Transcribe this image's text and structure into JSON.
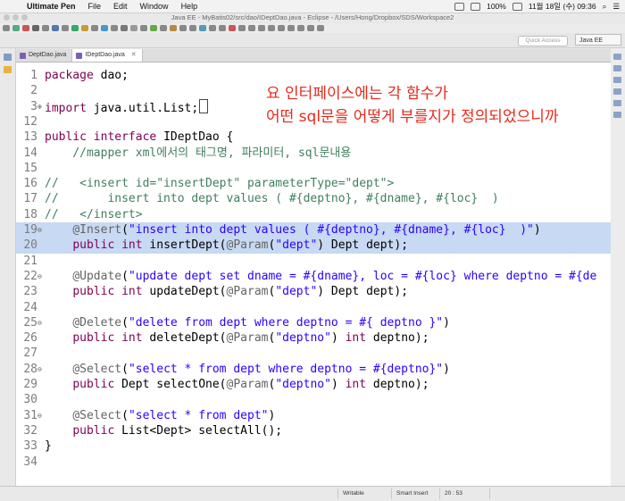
{
  "menubar": {
    "app_name": "Ultimate Pen",
    "items": [
      "File",
      "Edit",
      "Window",
      "Help"
    ],
    "battery": "100%",
    "date_time": "11월 18일 (수)  09:36"
  },
  "window": {
    "title": "Java EE - MyBatis02/src/dao/IDeptDao.java - Eclipse - /Users/Hong/Dropbox/SDS/Workspace2"
  },
  "toolbar": {
    "quick_access_placeholder": "Quick Access",
    "perspective_label": "Java EE"
  },
  "tabs": [
    {
      "label": "DeptDao.java",
      "active": false
    },
    {
      "label": "IDeptDao.java",
      "active": true,
      "close": "✕"
    }
  ],
  "annotation_note": {
    "line1": "요 인터페이스에는 각 함수가",
    "line2": "어떤 sql문을 어떻게 부를지가 정의되었으니까",
    "color": "#e8291c"
  },
  "code_lines": [
    {
      "n": "1",
      "fold": "",
      "parts": [
        [
          "kw",
          "package"
        ],
        [
          "t",
          " dao;"
        ]
      ]
    },
    {
      "n": "2",
      "fold": "",
      "parts": []
    },
    {
      "n": "3",
      "fold": "⊕",
      "parts": [
        [
          "kw",
          "import"
        ],
        [
          "t",
          " java.util.List;"
        ]
      ],
      "cursor": true
    },
    {
      "n": "12",
      "fold": "",
      "parts": []
    },
    {
      "n": "13",
      "fold": "",
      "parts": [
        [
          "kw",
          "public"
        ],
        [
          "t",
          " "
        ],
        [
          "kw",
          "interface"
        ],
        [
          "t",
          " IDeptDao {"
        ]
      ]
    },
    {
      "n": "14",
      "fold": "",
      "parts": [
        [
          "t",
          "    "
        ],
        [
          "com",
          "//mapper xml에서의 태그명, 파라미터, sql문내용"
        ]
      ]
    },
    {
      "n": "15",
      "fold": "",
      "parts": []
    },
    {
      "n": "16",
      "fold": "",
      "parts": [
        [
          "com",
          "//   <insert id=\"insertDept\" parameterType=\"dept\">"
        ]
      ]
    },
    {
      "n": "17",
      "fold": "",
      "parts": [
        [
          "com",
          "//       insert into dept values ( #{deptno}, #{dname}, #{loc}  )"
        ]
      ]
    },
    {
      "n": "18",
      "fold": "",
      "parts": [
        [
          "com",
          "//   </insert>"
        ]
      ]
    },
    {
      "n": "19",
      "fold": "⊖",
      "hl": true,
      "parts": [
        [
          "t",
          "    "
        ],
        [
          "ann",
          "@Insert"
        ],
        [
          "t",
          "("
        ],
        [
          "str",
          "\"insert into dept values ( #{deptno}, #{dname}, #{loc}  )\""
        ],
        [
          "t",
          ")"
        ]
      ]
    },
    {
      "n": "20",
      "fold": "",
      "hl": true,
      "parts": [
        [
          "t",
          "    "
        ],
        [
          "kw",
          "public"
        ],
        [
          "t",
          " "
        ],
        [
          "kw",
          "int"
        ],
        [
          "t",
          " insertDept("
        ],
        [
          "ann",
          "@Param"
        ],
        [
          "t",
          "("
        ],
        [
          "str",
          "\"dept\""
        ],
        [
          "t",
          ") Dept dept);"
        ]
      ]
    },
    {
      "n": "21",
      "fold": "",
      "parts": []
    },
    {
      "n": "22",
      "fold": "⊖",
      "parts": [
        [
          "t",
          "    "
        ],
        [
          "ann",
          "@Update"
        ],
        [
          "t",
          "("
        ],
        [
          "str",
          "\"update dept set dname = #{dname}, loc = #{loc} where deptno = #{de"
        ]
      ]
    },
    {
      "n": "23",
      "fold": "",
      "parts": [
        [
          "t",
          "    "
        ],
        [
          "kw",
          "public"
        ],
        [
          "t",
          " "
        ],
        [
          "kw",
          "int"
        ],
        [
          "t",
          " updateDept("
        ],
        [
          "ann",
          "@Param"
        ],
        [
          "t",
          "("
        ],
        [
          "str",
          "\"dept\""
        ],
        [
          "t",
          ") Dept dept);"
        ]
      ]
    },
    {
      "n": "24",
      "fold": "",
      "parts": []
    },
    {
      "n": "25",
      "fold": "⊖",
      "parts": [
        [
          "t",
          "    "
        ],
        [
          "ann",
          "@Delete"
        ],
        [
          "t",
          "("
        ],
        [
          "str",
          "\"delete from dept where deptno = #{ deptno }\""
        ],
        [
          "t",
          ")"
        ]
      ]
    },
    {
      "n": "26",
      "fold": "",
      "parts": [
        [
          "t",
          "    "
        ],
        [
          "kw",
          "public"
        ],
        [
          "t",
          " "
        ],
        [
          "kw",
          "int"
        ],
        [
          "t",
          " deleteDept("
        ],
        [
          "ann",
          "@Param"
        ],
        [
          "t",
          "("
        ],
        [
          "str",
          "\"deptno\""
        ],
        [
          "t",
          ") "
        ],
        [
          "kw",
          "int"
        ],
        [
          "t",
          " deptno);"
        ]
      ]
    },
    {
      "n": "27",
      "fold": "",
      "parts": []
    },
    {
      "n": "28",
      "fold": "⊖",
      "parts": [
        [
          "t",
          "    "
        ],
        [
          "ann",
          "@Select"
        ],
        [
          "t",
          "("
        ],
        [
          "str",
          "\"select * from dept where deptno = #{deptno}\""
        ],
        [
          "t",
          ")"
        ]
      ]
    },
    {
      "n": "29",
      "fold": "",
      "parts": [
        [
          "t",
          "    "
        ],
        [
          "kw",
          "public"
        ],
        [
          "t",
          " Dept selectOne("
        ],
        [
          "ann",
          "@Param"
        ],
        [
          "t",
          "("
        ],
        [
          "str",
          "\"deptno\""
        ],
        [
          "t",
          ") "
        ],
        [
          "kw",
          "int"
        ],
        [
          "t",
          " deptno);"
        ]
      ]
    },
    {
      "n": "30",
      "fold": "",
      "parts": []
    },
    {
      "n": "31",
      "fold": "⊖",
      "parts": [
        [
          "t",
          "    "
        ],
        [
          "ann",
          "@Select"
        ],
        [
          "t",
          "("
        ],
        [
          "str",
          "\"select * from dept\""
        ],
        [
          "t",
          ")"
        ]
      ]
    },
    {
      "n": "32",
      "fold": "",
      "parts": [
        [
          "t",
          "    "
        ],
        [
          "kw",
          "public"
        ],
        [
          "t",
          " List<Dept> selectAll();"
        ]
      ]
    },
    {
      "n": "33",
      "fold": "",
      "parts": [
        [
          "t",
          "}"
        ]
      ]
    },
    {
      "n": "34",
      "fold": "",
      "parts": []
    }
  ],
  "statusbar": {
    "writable": "Writable",
    "insert_mode": "Smart Insert",
    "position": "20 : 53"
  },
  "colors": {
    "keyword": "#7f0055",
    "string": "#2a00ff",
    "comment": "#3f7f5f",
    "annotation": "#646464",
    "highlight": "#c7d9f3"
  }
}
